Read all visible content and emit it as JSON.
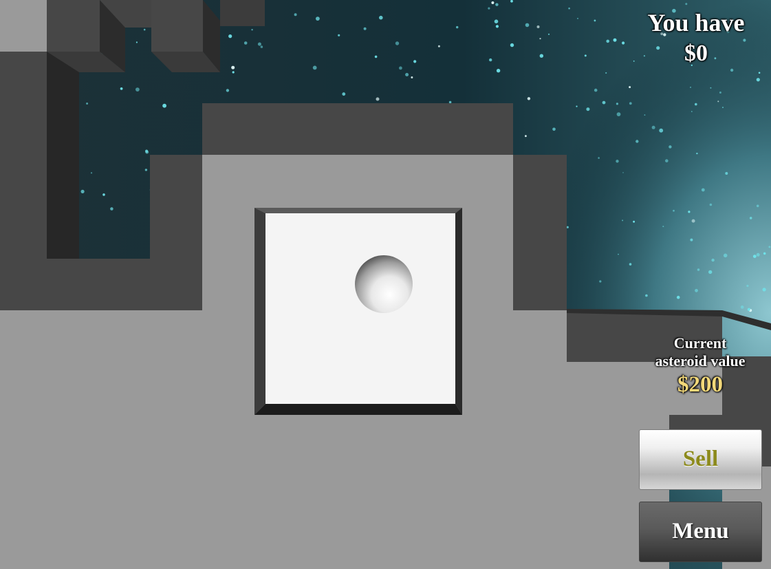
{
  "hud": {
    "money_label": "You have",
    "money_value": "$0",
    "asteroid_value_label_line1": "Current",
    "asteroid_value_label_line2": "asteroid value",
    "asteroid_value": "$200"
  },
  "buttons": {
    "sell_label": "Sell",
    "menu_label": "Menu"
  },
  "colors": {
    "space": "#0c2a33",
    "block_light": "#9a9a9a",
    "block_dark": "#474747",
    "block_shadow": "#2a2a2a",
    "panel_white": "#f4f4f4",
    "value_gold": "#f3d97a",
    "sell_text": "#8c8a1c"
  },
  "icons": {
    "ball": "sphere-ball-icon"
  }
}
